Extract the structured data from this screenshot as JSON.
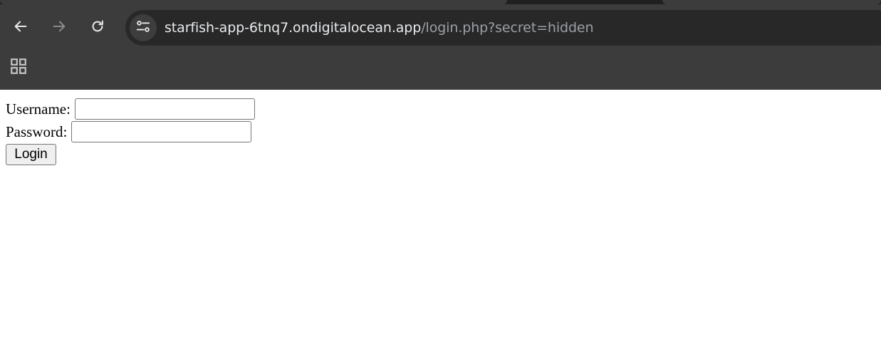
{
  "browser": {
    "address_bar": {
      "host": "starfish-app-6tnq7.ondigitalocean.app",
      "path": "/login.php?secret=hidden"
    },
    "icons": {
      "back": "arrow-left-icon",
      "forward": "arrow-right-icon",
      "reload": "reload-icon",
      "site_info": "tune-icon",
      "apps": "apps-grid-icon"
    },
    "colors": {
      "chrome_background": "#3c3c3c",
      "omnibox_background": "#282828",
      "url_host": "#e8eaed",
      "url_path": "#9aa0a6"
    }
  },
  "login_form": {
    "username_label": "Username:",
    "username_value": "",
    "password_label": "Password:",
    "password_value": "",
    "submit_label": "Login"
  }
}
